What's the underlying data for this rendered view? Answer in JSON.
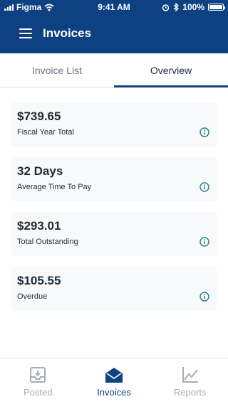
{
  "status_bar": {
    "carrier": "Figma",
    "time": "9:41 AM",
    "battery": "100%",
    "battery_level": 1.0
  },
  "nav": {
    "title": "Invoices"
  },
  "tabs": [
    {
      "label": "Invoice List",
      "active": false
    },
    {
      "label": "Overview",
      "active": true
    }
  ],
  "cards": [
    {
      "value": "$739.65",
      "label": "Fiscal Year Total"
    },
    {
      "value": "32 Days",
      "label": "Average Time To Pay"
    },
    {
      "value": "$293.01",
      "label": "Total Outstanding"
    },
    {
      "value": "$105.55",
      "label": "Overdue"
    }
  ],
  "bottom_nav": [
    {
      "label": "Posted",
      "icon": "inbox-icon",
      "active": false
    },
    {
      "label": "Invoices",
      "icon": "envelope-icon",
      "active": true
    },
    {
      "label": "Reports",
      "icon": "chart-icon",
      "active": false
    }
  ],
  "colors": {
    "brand": "#0d4182",
    "info": "#2a7d8a",
    "inactive": "#a7adb4",
    "card_bg": "#f7f9fb"
  }
}
